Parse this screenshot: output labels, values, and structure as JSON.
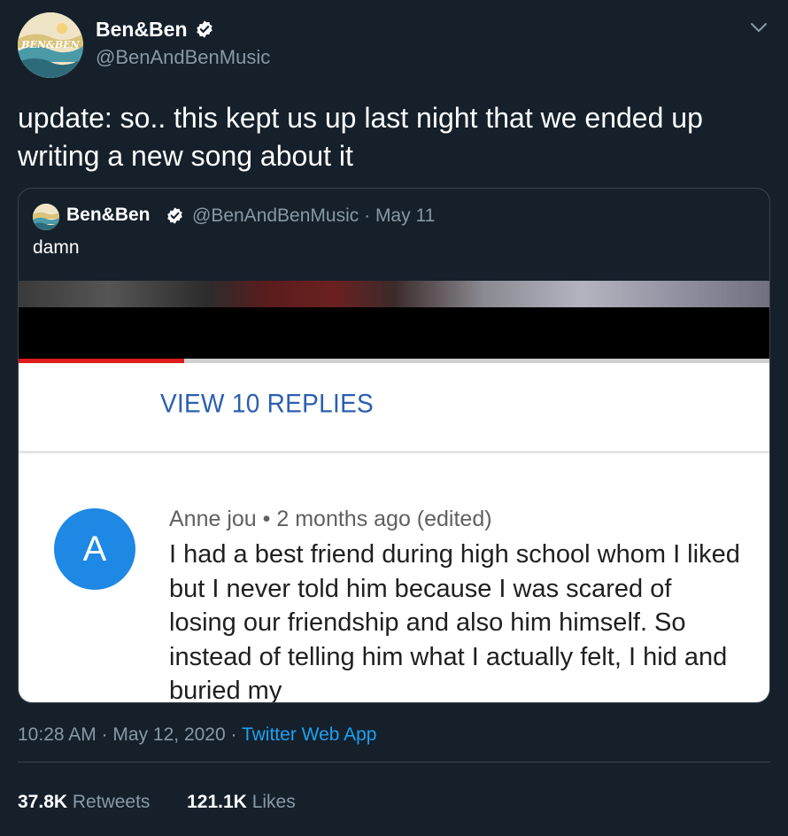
{
  "author": {
    "name": "Ben&Ben",
    "handle": "@BenAndBenMusic",
    "avatar_text": "BEN&BEN"
  },
  "tweet": {
    "text": "update: so.. this kept us up last night that we ended up writing a new song about it"
  },
  "quoted": {
    "name": "Ben&Ben",
    "handle": "@BenAndBenMusic",
    "date": "May 11",
    "text": "damn",
    "media": {
      "video_progress_percent": 22,
      "view_replies": "VIEW 10 REPLIES",
      "comment": {
        "avatar_letter": "A",
        "author": "Anne jou",
        "time": "2 months ago (edited)",
        "body": "I had a best friend during high school whom I liked but I never told him because I was scared of losing our friendship and also him himself. So instead of telling him what I actually felt, I hid and buried my"
      }
    }
  },
  "meta": {
    "time": "10:28 AM",
    "date": "May 12, 2020",
    "source": "Twitter Web App"
  },
  "stats": {
    "retweets_count": "37.8K",
    "retweets_label": "Retweets",
    "likes_count": "121.1K",
    "likes_label": "Likes"
  },
  "colors": {
    "background": "#15202b",
    "secondary_text": "#8899a6",
    "link": "#1da1f2",
    "border": "#38444d"
  }
}
